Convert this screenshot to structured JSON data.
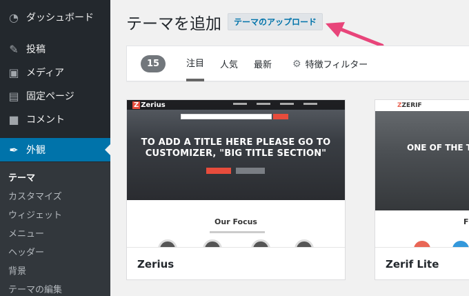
{
  "sidebar": {
    "items": [
      {
        "label": "ダッシュボード",
        "icon": "dashboard-icon"
      },
      {
        "label": "投稿",
        "icon": "pin-icon"
      },
      {
        "label": "メディア",
        "icon": "media-icon"
      },
      {
        "label": "固定ページ",
        "icon": "page-icon"
      },
      {
        "label": "コメント",
        "icon": "comment-icon"
      },
      {
        "label": "外観",
        "icon": "brush-icon"
      }
    ],
    "submenu": [
      "テーマ",
      "カスタマイズ",
      "ウィジェット",
      "メニュー",
      "ヘッダー",
      "背景",
      "テーマの編集"
    ],
    "accent_color": "#0073aa"
  },
  "header": {
    "title": "テーマを追加",
    "upload_label": "テーマのアップロード",
    "arrow_color": "#e8457a"
  },
  "filter": {
    "count": "15",
    "tabs": [
      "注目",
      "人気",
      "最新"
    ],
    "feature_filter": "特徴フィルター"
  },
  "themes": [
    {
      "name": "Zerius",
      "logo": "Zerius",
      "headline": "TO ADD A TITLE HERE PLEASE GO TO CUSTOMIZER, \"BIG TITLE SECTION\"",
      "section_title": "Our Focus"
    },
    {
      "name": "Zerif Lite",
      "logo": "ZERIF",
      "headline": "ONE OF THE TO THEMES ON",
      "section_title": "F"
    }
  ]
}
